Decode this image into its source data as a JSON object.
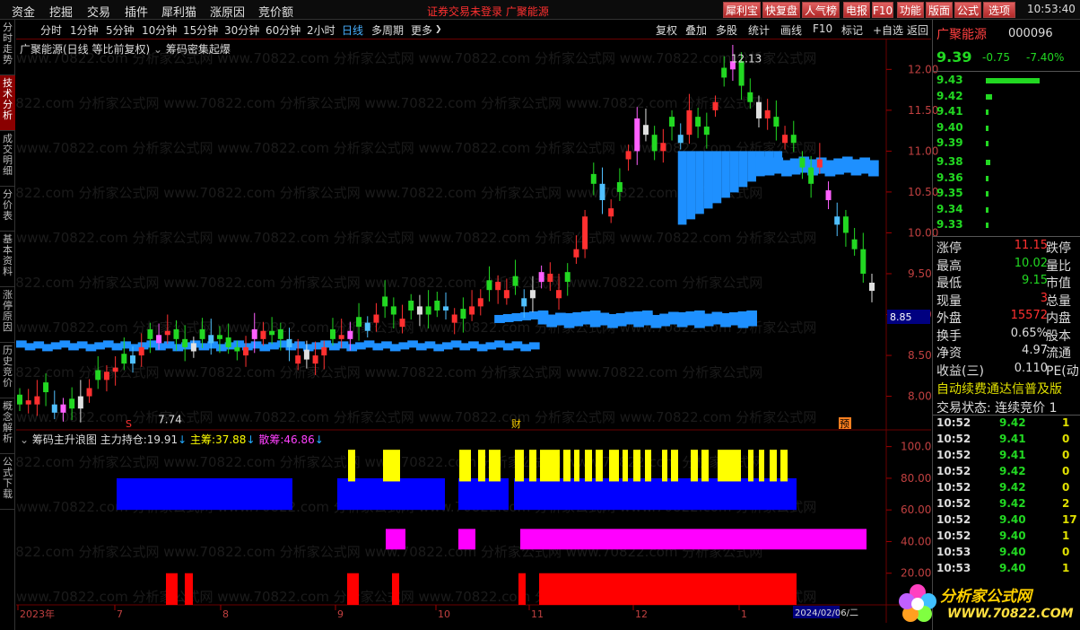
{
  "menu": [
    "资金",
    "挖掘",
    "交易",
    "插件",
    "犀利猫",
    "涨原因",
    "竞价额"
  ],
  "notice": "证券交易未登录  广聚能源",
  "top_buttons": [
    "犀利宝",
    "快复盘",
    "人气榜",
    "电报",
    "F10",
    "功能",
    "版面",
    "公式",
    "选项"
  ],
  "clock": "10:53:40",
  "left_tabs": [
    "分时走势",
    "技术分析",
    "成交明细",
    "分价表",
    "基本资料",
    "涨停原因",
    "历史竞价",
    "概念解析",
    "公式下载"
  ],
  "periods": [
    "分时",
    "1分钟",
    "5分钟",
    "10分钟",
    "15分钟",
    "30分钟",
    "60分钟",
    "2小时",
    "日线",
    "多周期",
    "更多"
  ],
  "tools": [
    "复权",
    "叠加",
    "多股",
    "统计",
    "画线",
    "F10",
    "标记",
    "+自选",
    "返回"
  ],
  "main_title": "广聚能源(日线 等比前复权)",
  "main_indicator": "筹码密集起爆",
  "indicator_header": {
    "name": "筹码主升浪图",
    "main_label": "主力持仓:",
    "main_val": "19.91",
    "zhu_label": "主筹:",
    "zhu_val": "37.88",
    "san_label": "散筹:",
    "san_val": "46.86"
  },
  "price_axis": [
    "12.00",
    "11.50",
    "11.00",
    "10.50",
    "10.00",
    "9.50",
    "9.00",
    "8.50",
    "8.00"
  ],
  "cursor_price": "8.85",
  "high_marker": "12.13",
  "low_marker": "7.74",
  "markers": {
    "s": "S",
    "cai": "财",
    "yu": "预"
  },
  "ind_axis": [
    "100.0",
    "80.00",
    "60.00",
    "40.00",
    "20.00"
  ],
  "date_axis": [
    "2023年",
    "7",
    "8",
    "9",
    "10",
    "11",
    "12",
    "1"
  ],
  "date_cursor": "2024/02/06/二",
  "stock": {
    "name": "广聚能源",
    "code": "000096",
    "price": "9.39",
    "change": "-0.75",
    "pct": "-7.40%"
  },
  "asks": [
    {
      "p": "9.43",
      "w": 60
    },
    {
      "p": "9.42",
      "w": 7
    },
    {
      "p": "9.41",
      "w": 3
    },
    {
      "p": "9.40",
      "w": 3
    },
    {
      "p": "9.39",
      "w": 3
    }
  ],
  "bids": [
    {
      "p": "9.38",
      "w": 5
    },
    {
      "p": "9.36",
      "w": 3
    },
    {
      "p": "9.35",
      "w": 3
    },
    {
      "p": "9.34",
      "w": 3
    },
    {
      "p": "9.33",
      "w": 3
    }
  ],
  "stats": [
    {
      "l": "涨停",
      "v": "11.15",
      "c": "#ff3030",
      "r": "跌停"
    },
    {
      "l": "最高",
      "v": "10.02",
      "c": "#22d822",
      "r": "量比"
    },
    {
      "l": "最低",
      "v": "9.15",
      "c": "#22d822",
      "r": "市值"
    },
    {
      "l": "现量",
      "v": "3",
      "c": "#ff3030",
      "r": "总量"
    },
    {
      "l": "外盘",
      "v": "15572",
      "c": "#ff3030",
      "r": "内盘"
    },
    {
      "l": "换手",
      "v": "0.65%",
      "c": "#ddd",
      "r": "股本"
    },
    {
      "l": "净资",
      "v": "4.97",
      "c": "#ddd",
      "r": "流通"
    },
    {
      "l": "收益(三)",
      "v": "0.110",
      "c": "#ddd",
      "r": "PE(动"
    }
  ],
  "scroll_notice": "自动续费通达信普及版",
  "trade_status": "交易状态: 连续竞价 1",
  "ticks": [
    {
      "t": "10:52",
      "p": "9.42",
      "v": "1"
    },
    {
      "t": "10:52",
      "p": "9.41",
      "v": "0"
    },
    {
      "t": "10:52",
      "p": "9.41",
      "v": "0"
    },
    {
      "t": "10:52",
      "p": "9.42",
      "v": "0"
    },
    {
      "t": "10:52",
      "p": "9.42",
      "v": "0"
    },
    {
      "t": "10:52",
      "p": "9.42",
      "v": "2"
    },
    {
      "t": "10:52",
      "p": "9.40",
      "v": "17"
    },
    {
      "t": "10:52",
      "p": "9.40",
      "v": "1"
    },
    {
      "t": "10:53",
      "p": "9.40",
      "v": "0"
    },
    {
      "t": "10:53",
      "p": "9.40",
      "v": "1"
    }
  ],
  "watermark": "www.70822.com 分析家公式网",
  "logo": {
    "text": "分析家公式网",
    "url": "WWW.70822.COM"
  },
  "colors": {
    "up": "#ff3030",
    "down": "#22d822",
    "chip": "#1e90ff",
    "yellow": "#ffff00",
    "blue": "#0000ff",
    "magenta": "#ff00ff",
    "red": "#ff0000"
  },
  "chart_data": [
    {
      "type": "candlestick",
      "title": "广聚能源(日线 等比前复权)",
      "y_range": [
        7.6,
        12.3
      ],
      "high": 12.13,
      "low": 7.74,
      "x_labels": [
        "2023年",
        "7",
        "8",
        "9",
        "10",
        "11",
        "12",
        "1"
      ],
      "close_series": [
        7.9,
        7.95,
        8.0,
        8.05,
        7.9,
        7.8,
        7.85,
        8.0,
        8.1,
        8.2,
        8.3,
        8.35,
        8.4,
        8.5,
        8.6,
        8.7,
        8.75,
        8.8,
        8.7,
        8.6,
        8.65,
        8.7,
        8.75,
        8.7,
        8.6,
        8.55,
        8.6,
        8.7,
        8.8,
        8.75,
        8.7,
        8.6,
        8.5,
        8.45,
        8.5,
        8.6,
        8.7,
        8.75,
        8.8,
        8.85,
        8.9,
        9.0,
        9.1,
        9.0,
        8.95,
        9.05,
        9.1,
        9.0,
        9.05,
        9.1,
        9.0,
        8.95,
        9.1,
        9.2,
        9.3,
        9.4,
        9.3,
        9.35,
        9.2,
        9.3,
        9.4,
        9.5,
        9.3,
        9.4,
        9.8,
        10.2,
        10.6,
        10.4,
        10.3,
        10.5,
        11.0,
        11.4,
        11.2,
        11.0,
        11.1,
        11.3,
        11.2,
        11.5,
        11.3,
        11.2,
        11.6,
        11.9,
        12.1,
        11.8,
        11.6,
        11.4,
        11.5,
        11.3,
        11.2,
        11.1,
        10.8,
        10.6,
        10.9,
        10.4,
        10.2,
        10.0,
        9.8,
        9.5,
        9.39
      ]
    },
    {
      "type": "bar",
      "title": "筹码主升浪图",
      "y_range": [
        0,
        110
      ],
      "series": [
        {
          "name": "主力持仓",
          "last": 19.91
        },
        {
          "name": "主筹",
          "last": 37.88
        },
        {
          "name": "散筹",
          "last": 46.86
        }
      ]
    }
  ]
}
